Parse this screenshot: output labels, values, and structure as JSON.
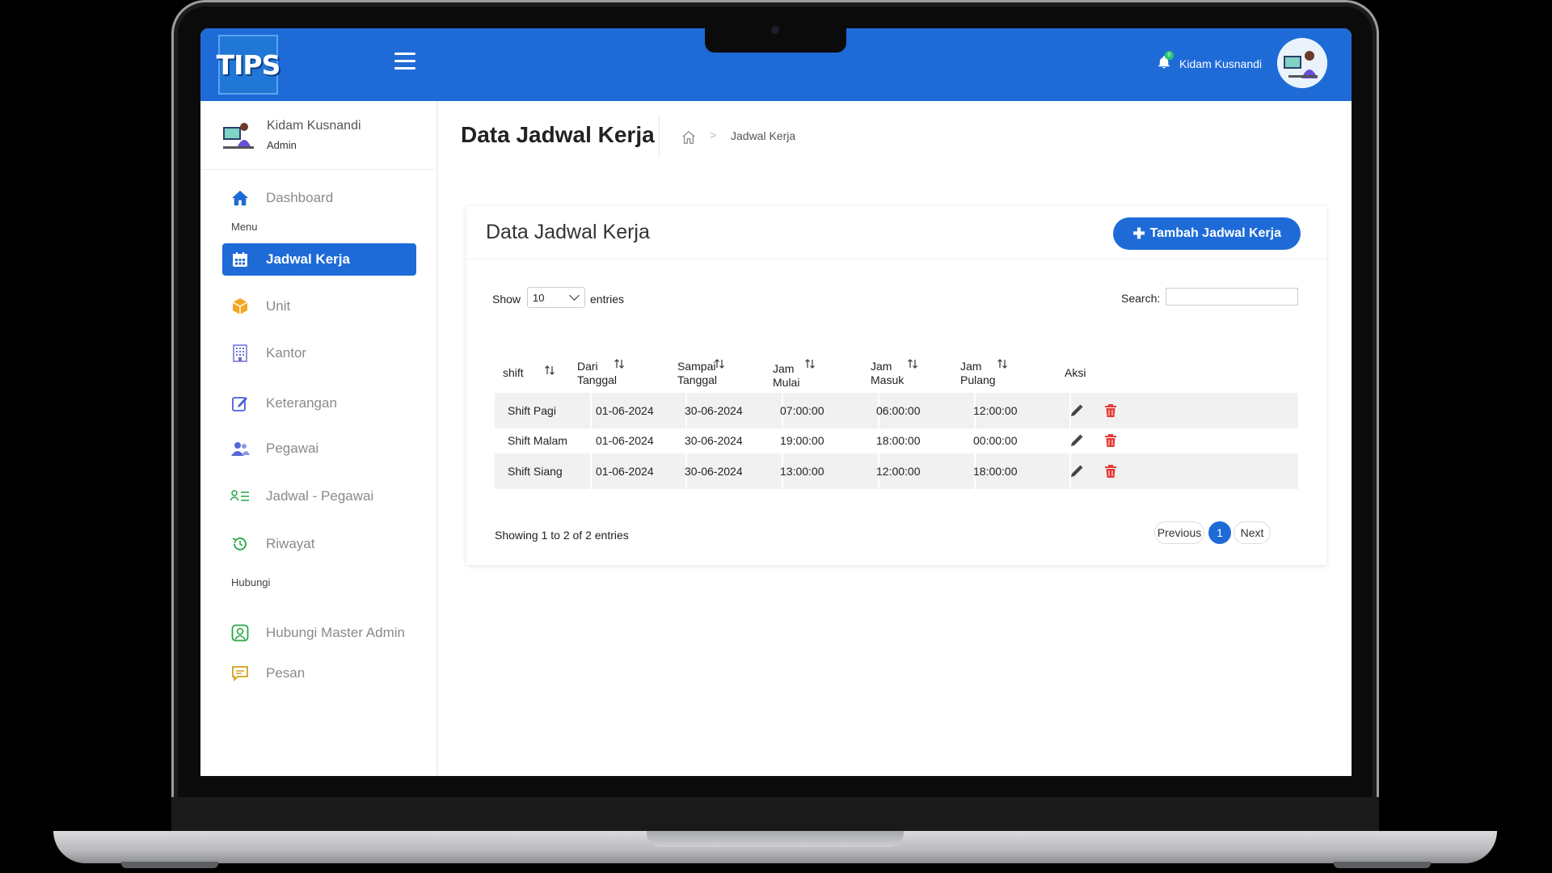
{
  "app": {
    "logo_text": "TIPS"
  },
  "header": {
    "user_name": "Kidam Kusnandi",
    "notification_count": "0"
  },
  "sidebar": {
    "user_name": "Kidam Kusnandi",
    "user_role": "Admin",
    "section_menu": "Menu",
    "section_contact": "Hubungi",
    "items": [
      {
        "label": "Dashboard",
        "icon": "home-icon",
        "color": "#1e6bd8"
      },
      {
        "label": "Jadwal Kerja",
        "icon": "calendar-icon",
        "color": "#ffffff",
        "active": true
      },
      {
        "label": "Unit",
        "icon": "box-icon",
        "color": "#f5a623"
      },
      {
        "label": "Kantor",
        "icon": "building-icon",
        "color": "#6f6fd6"
      },
      {
        "label": "Keterangan",
        "icon": "edit-note-icon",
        "color": "#4a5fd6"
      },
      {
        "label": "Pegawai",
        "icon": "users-icon",
        "color": "#5468d6"
      },
      {
        "label": "Jadwal - Pegawai",
        "icon": "list-user-icon",
        "color": "#28a745"
      },
      {
        "label": "Riwayat",
        "icon": "history-icon",
        "color": "#28a745"
      },
      {
        "label": "Hubungi Master Admin",
        "icon": "contact-icon",
        "color": "#28a745"
      },
      {
        "label": "Pesan",
        "icon": "message-icon",
        "color": "#d4a017"
      }
    ]
  },
  "page": {
    "title": "Data Jadwal Kerja",
    "breadcrumb_current": "Jadwal Kerja"
  },
  "card": {
    "title": "Data Jadwal Kerja",
    "add_button": "Tambah Jadwal Kerja",
    "show_label": "Show",
    "show_value": "10",
    "entries_label": "entries",
    "search_label": "Search:",
    "search_value": ""
  },
  "table": {
    "headers": [
      "shift",
      "Dari Tanggal",
      "Sampai Tanggal",
      "Jam Mulai",
      "Jam Masuk",
      "Jam Pulang",
      "Aksi"
    ],
    "rows": [
      [
        "Shift Pagi",
        "01-06-2024",
        "30-06-2024",
        "07:00:00",
        "06:00:00",
        "12:00:00"
      ],
      [
        "Shift Malam",
        "01-06-2024",
        "30-06-2024",
        "19:00:00",
        "18:00:00",
        "00:00:00"
      ],
      [
        "Shift Siang",
        "01-06-2024",
        "30-06-2024",
        "13:00:00",
        "12:00:00",
        "18:00:00"
      ]
    ]
  },
  "footer": {
    "info": "Showing 1 to 2 of 2 entries",
    "prev": "Previous",
    "page": "1",
    "next": "Next"
  },
  "colors": {
    "primary": "#1e6bd8",
    "delete": "#e53935",
    "edit": "#444444"
  }
}
